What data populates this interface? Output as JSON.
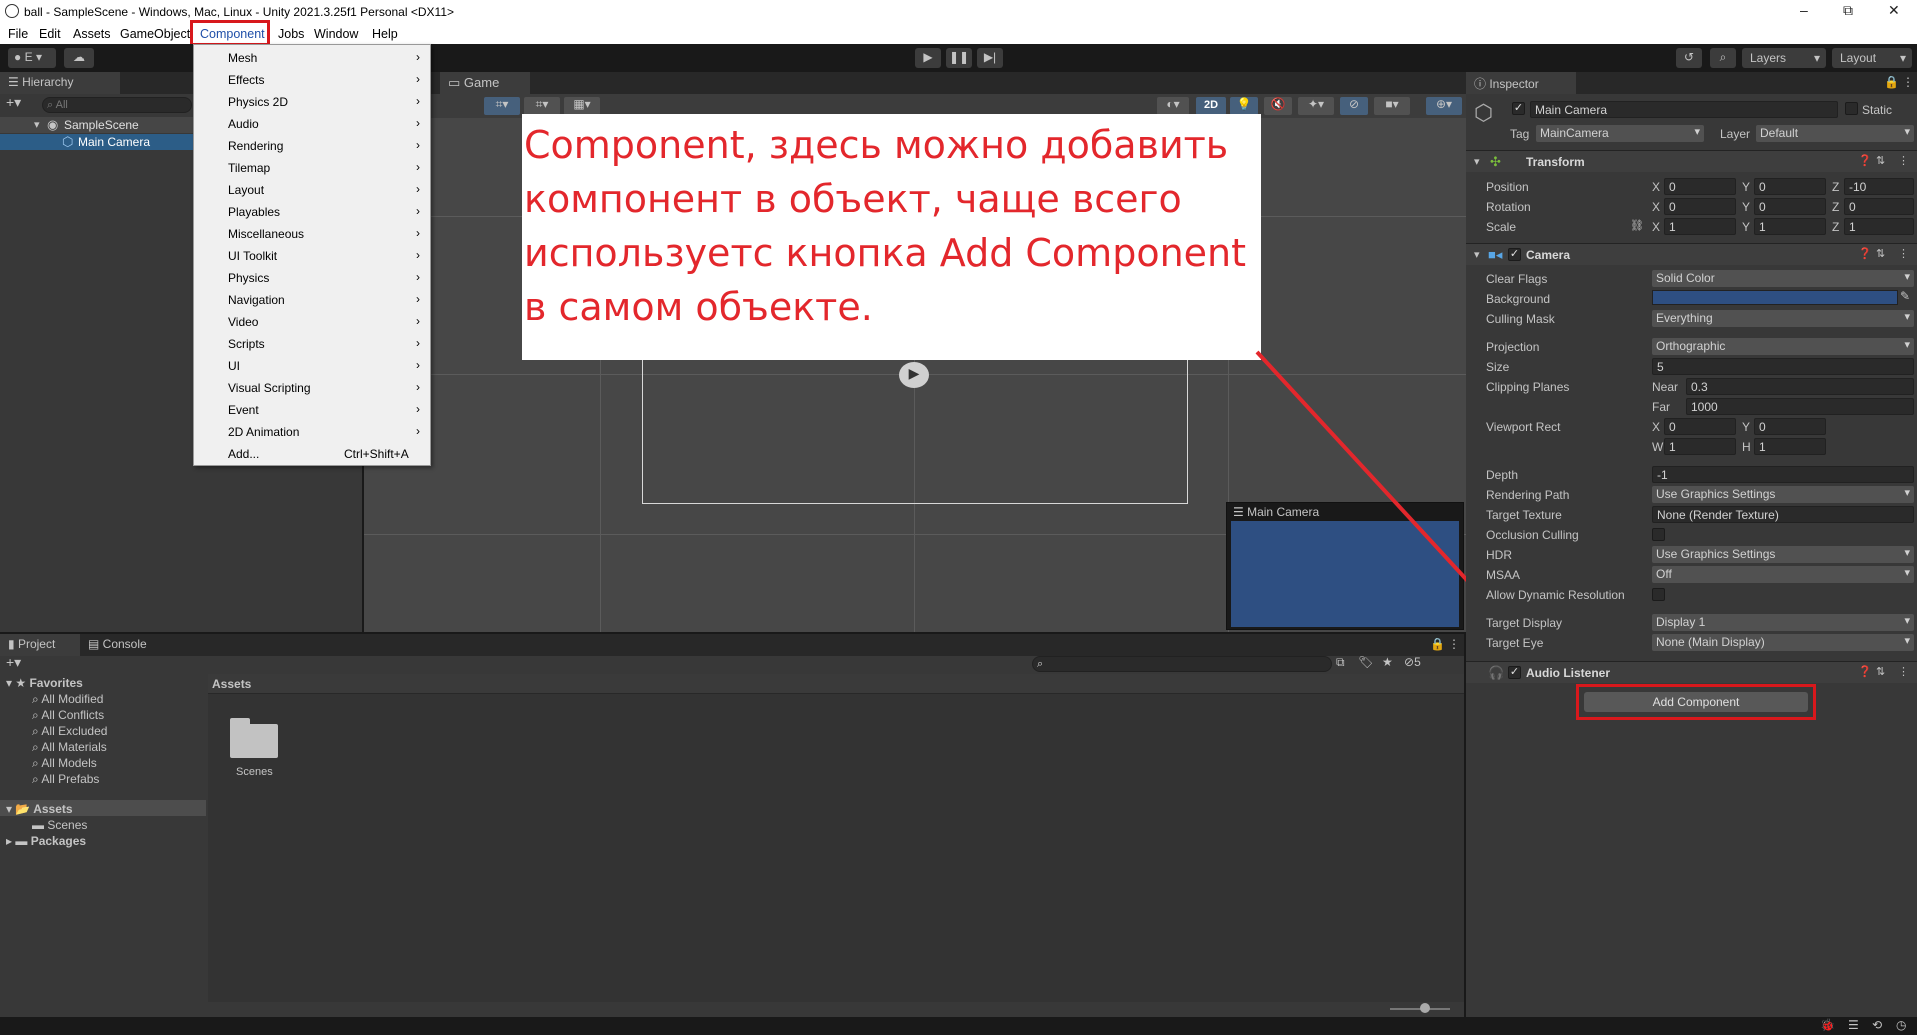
{
  "window": {
    "title": "ball - SampleScene - Windows, Mac, Linux - Unity 2021.3.25f1 Personal <DX11>",
    "minimize": "–",
    "maximize": "⧉",
    "close": "✕"
  },
  "menu": [
    "File",
    "Edit",
    "Assets",
    "GameObject",
    "Component",
    "Jobs",
    "Window",
    "Help"
  ],
  "toolbar": {
    "account": "E",
    "layers": "Layers",
    "layout": "Layout"
  },
  "hierarchy": {
    "tab": "Hierarchy",
    "search_placeholder": "All",
    "scene": "SampleScene",
    "object": "Main Camera"
  },
  "scene_tabs": {
    "game": "Game"
  },
  "scene_toolbar": {
    "mode2d": "2D"
  },
  "component_menu": [
    {
      "label": "Mesh",
      "sub": true
    },
    {
      "label": "Effects",
      "sub": true
    },
    {
      "label": "Physics 2D",
      "sub": true
    },
    {
      "label": "Audio",
      "sub": true
    },
    {
      "label": "Rendering",
      "sub": true
    },
    {
      "label": "Tilemap",
      "sub": true
    },
    {
      "label": "Layout",
      "sub": true
    },
    {
      "label": "Playables",
      "sub": true
    },
    {
      "label": "Miscellaneous",
      "sub": true
    },
    {
      "label": "UI Toolkit",
      "sub": true
    },
    {
      "label": "Physics",
      "sub": true
    },
    {
      "label": "Navigation",
      "sub": true
    },
    {
      "label": "Video",
      "sub": true
    },
    {
      "label": "Scripts",
      "sub": true
    },
    {
      "label": "UI",
      "sub": true
    },
    {
      "label": "Visual Scripting",
      "sub": true
    },
    {
      "label": "Event",
      "sub": true
    },
    {
      "label": "2D Animation",
      "sub": true
    },
    {
      "label": "Add...",
      "shortcut": "Ctrl+Shift+A"
    }
  ],
  "annotation": {
    "text": "Component, здесь можно добавить компонент в объект, чаще всего используетс кнопка Add Component в самом объекте."
  },
  "camera_preview": {
    "title": "Main Camera",
    "color": "#2e4f82"
  },
  "inspector": {
    "tab": "Inspector",
    "object_name": "Main Camera",
    "static_label": "Static",
    "tag_label": "Tag",
    "tag": "MainCamera",
    "layer_label": "Layer",
    "layer": "Default",
    "transform": {
      "title": "Transform",
      "position_label": "Position",
      "position": {
        "x": "0",
        "y": "0",
        "z": "-10"
      },
      "rotation_label": "Rotation",
      "rotation": {
        "x": "0",
        "y": "0",
        "z": "0"
      },
      "scale_label": "Scale",
      "scale": {
        "x": "1",
        "y": "1",
        "z": "1"
      }
    },
    "camera": {
      "title": "Camera",
      "clear_flags_label": "Clear Flags",
      "clear_flags": "Solid Color",
      "background_label": "Background",
      "background_color": "#2e4f82",
      "culling_mask_label": "Culling Mask",
      "culling_mask": "Everything",
      "projection_label": "Projection",
      "projection": "Orthographic",
      "size_label": "Size",
      "size": "5",
      "clipping_label": "Clipping Planes",
      "near_label": "Near",
      "near": "0.3",
      "far_label": "Far",
      "far": "1000",
      "viewport_label": "Viewport Rect",
      "vx": "0",
      "vy": "0",
      "vw": "1",
      "vh": "1",
      "depth_label": "Depth",
      "depth": "-1",
      "rendering_path_label": "Rendering Path",
      "rendering_path": "Use Graphics Settings",
      "target_texture_label": "Target Texture",
      "target_texture": "None (Render Texture)",
      "occlusion_label": "Occlusion Culling",
      "hdr_label": "HDR",
      "hdr": "Use Graphics Settings",
      "msaa_label": "MSAA",
      "msaa": "Off",
      "dynres_label": "Allow Dynamic Resolution",
      "target_display_label": "Target Display",
      "target_display": "Display 1",
      "target_eye_label": "Target Eye",
      "target_eye": "None (Main Display)"
    },
    "audio_listener": {
      "title": "Audio Listener"
    },
    "add_component": "Add Component"
  },
  "project": {
    "tabs": [
      "Project",
      "Console"
    ],
    "favorites_label": "Favorites",
    "favorites": [
      "All Modified",
      "All Conflicts",
      "All Excluded",
      "All Materials",
      "All Models",
      "All Prefabs"
    ],
    "assets_label": "Assets",
    "scenes_label": "Scenes",
    "packages_label": "Packages",
    "breadcrumb": "Assets",
    "folder": "Scenes",
    "hidden_count": "5"
  }
}
